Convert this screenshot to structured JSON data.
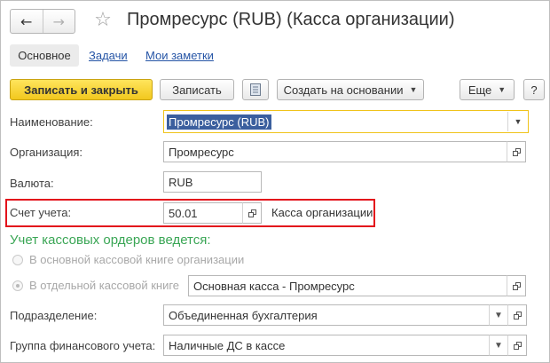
{
  "window": {
    "title": "Промресурс (RUB) (Касса организации)",
    "nav_back_icon": "arrow-left-icon",
    "nav_forward_icon": "arrow-right-icon",
    "favorite_icon": "star-icon"
  },
  "tabs": [
    {
      "label": "Основное",
      "active": true
    },
    {
      "label": "Задачи",
      "active": false
    },
    {
      "label": "Мои заметки",
      "active": false
    }
  ],
  "toolbar": {
    "save_close_label": "Записать и закрыть",
    "save_label": "Записать",
    "list_icon": "document-list-icon",
    "create_based_label": "Создать на основании",
    "more_label": "Еще",
    "help_label": "?"
  },
  "form": {
    "name": {
      "label": "Наименование:",
      "value": "Промресурс (RUB)"
    },
    "organization": {
      "label": "Организация:",
      "value": "Промресурс"
    },
    "currency": {
      "label": "Валюта:",
      "value": "RUB"
    },
    "account": {
      "label": "Счет учета:",
      "value": "50.01",
      "description": "Касса организации"
    },
    "orders_section": {
      "title": "Учет кассовых ордеров ведется:",
      "option_main": "В основной кассовой книге организации",
      "option_separate": "В отдельной кассовой книге",
      "separate_book_value": "Основная касса - Промресурс"
    },
    "department": {
      "label": "Подразделение:",
      "value": "Объединенная бухгалтерия"
    },
    "fin_group": {
      "label": "Группа финансового учета:",
      "value": "Наличные ДС в кассе"
    }
  },
  "colors": {
    "primary_button": "#f2c81e",
    "link": "#2655a6",
    "section_title": "#3aa655",
    "highlight_border": "#e3121b",
    "focus_border": "#f0c31a",
    "selection": "#3b5f9e"
  }
}
